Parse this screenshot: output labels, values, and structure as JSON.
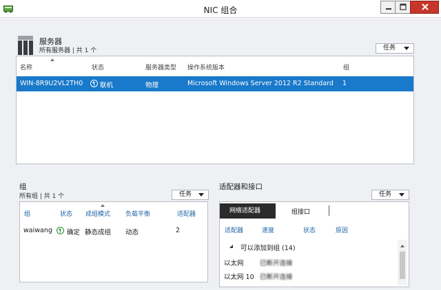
{
  "window": {
    "title": "NIC 组合",
    "icon": "nic-teaming-app-icon",
    "buttons": [
      "minimize-icon",
      "maximize-icon",
      "close-icon"
    ]
  },
  "servers": {
    "title": "服务器",
    "subtitle": "所有服务器 | 共 1 个",
    "tasks_label": "任务",
    "columns": [
      "名称",
      "状态",
      "服务器类型",
      "操作系统版本",
      "组"
    ],
    "rows": [
      {
        "name": "WIN-8R9U2VL2TH0",
        "status": "联机",
        "type": "物理",
        "os": "Microsoft Windows Server 2012 R2 Standard",
        "group": "1"
      }
    ]
  },
  "teams": {
    "title": "组",
    "subtitle": "所有组 | 共 1 个",
    "tasks_label": "任务",
    "columns": [
      "组",
      "状态",
      "成组模式",
      "负载平衡",
      "适配器"
    ],
    "rows": [
      {
        "team": "waiwang",
        "status": "确定",
        "mode": "静态成组",
        "balance": "动态",
        "adapters": "2"
      }
    ]
  },
  "adapters": {
    "title": "适配器和接口",
    "tasks_label": "任务",
    "tabs": [
      "网络适配器",
      "组接口"
    ],
    "columns": [
      "适配器",
      "速度",
      "状态",
      "原因"
    ],
    "group_header": "可以添加到组 (14)",
    "rows": [
      {
        "name": "以太网",
        "status": "已断开连接"
      },
      {
        "name": "以太网 10",
        "status": "已断开连接"
      }
    ]
  },
  "colors": {
    "selection": "#1979ca",
    "ok_status": "#2c8a2c",
    "link_header": "#2266a8",
    "close_button": "#c7362b"
  }
}
